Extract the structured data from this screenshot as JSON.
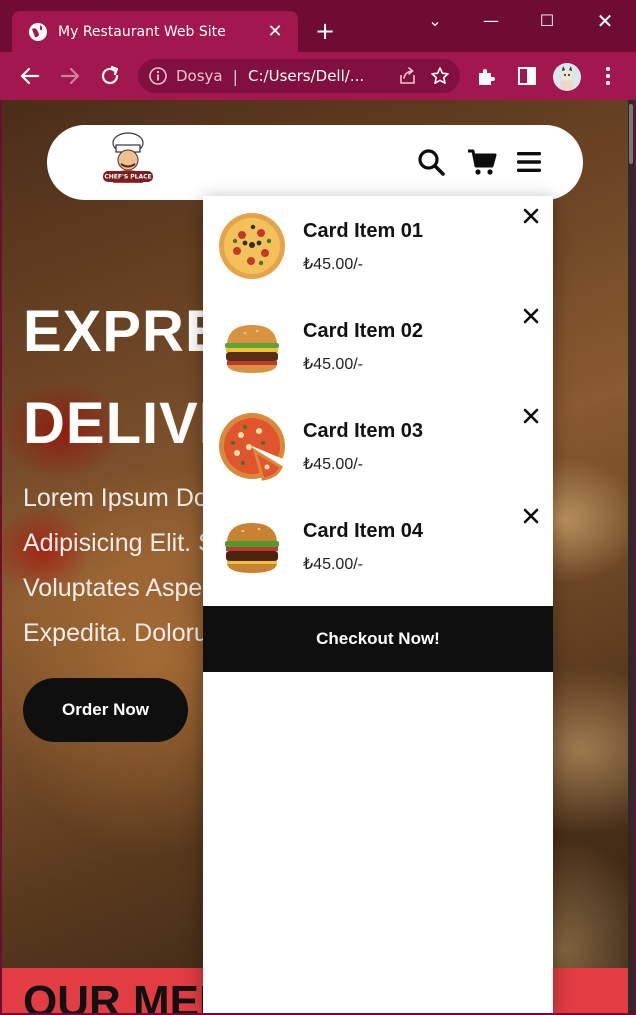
{
  "browser": {
    "tab_title": "My Restaurant Web Site",
    "tab_close": "✕",
    "new_tab": "+",
    "window": {
      "chevron": "⌄",
      "minimize": "—",
      "maximize": "☐",
      "close": "✕"
    },
    "omnibox": {
      "label": "Dosya",
      "separator": "|",
      "url": "C:/Users/Dell/..."
    },
    "icons": [
      "globe-icon",
      "back-arrow-icon",
      "forward-arrow-icon",
      "reload-icon",
      "info-icon",
      "share-icon",
      "star-icon",
      "puzzle-extension-icon",
      "side-panel-icon",
      "avatar",
      "kebab-menu-icon"
    ]
  },
  "page": {
    "navbar_icons": [
      "search-icon",
      "cart-icon",
      "bars-menu-icon"
    ],
    "hero": {
      "title_line1": "EXPRESS",
      "title_line2": "DELIVERY",
      "text_line1": "Lorem Ipsum Dolor Sit Amet",
      "text_line2": "Adipisicing Elit. Sequi",
      "text_line3": "Voluptates Aspernatur",
      "text_line4": "Expedita. Dolorum Ipsum!",
      "order_button": "Order Now"
    },
    "menu_heading": "OUR MENU"
  },
  "cart": {
    "items": [
      {
        "name": "Card Item 01",
        "price": "₺45.00/-",
        "image": "pizza"
      },
      {
        "name": "Card Item 02",
        "price": "₺45.00/-",
        "image": "burger"
      },
      {
        "name": "Card Item 03",
        "price": "₺45.00/-",
        "image": "pizza-slice"
      },
      {
        "name": "Card Item 04",
        "price": "₺45.00/-",
        "image": "burger"
      }
    ],
    "checkout_label": "Checkout Now!"
  },
  "colors": {
    "titlebar": "#6e0c34",
    "tab_and_toolbar": "#a3174f",
    "dark_button": "#0f0f10",
    "menu_band": "#e13d42"
  }
}
